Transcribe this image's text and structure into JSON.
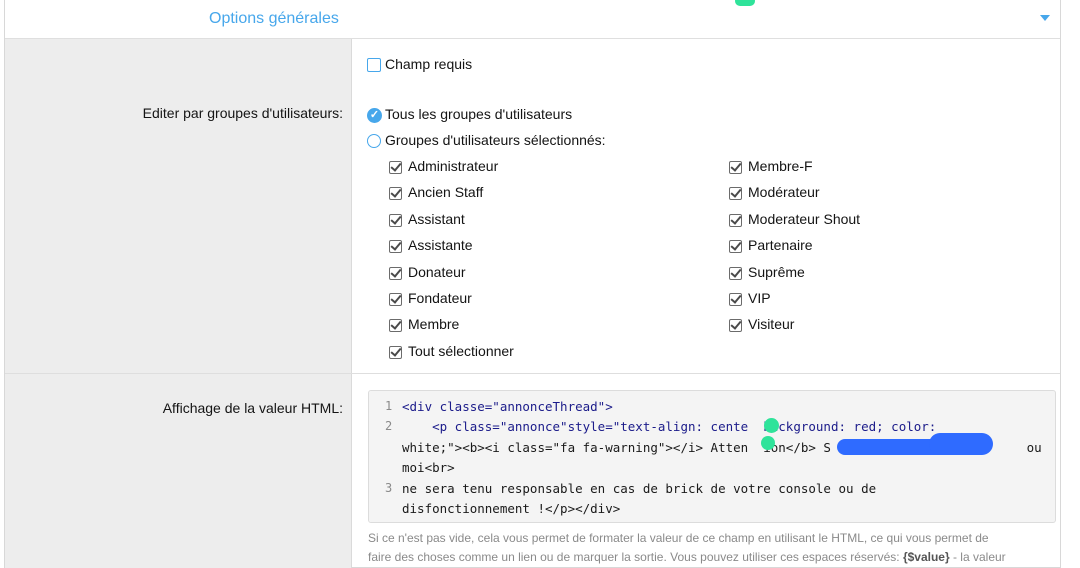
{
  "header": {
    "title": "Options générales"
  },
  "labels": {
    "edit_groups": "Editer par groupes d'utilisateurs:",
    "html_display": "Affichage de la valeur HTML:"
  },
  "options": {
    "required_field": "Champ requis",
    "all_groups": "Tous les groupes d'utilisateurs",
    "selected_groups": "Groupes d'utilisateurs sélectionnés:"
  },
  "groups_left": [
    "Administrateur",
    "Ancien Staff",
    "Assistant",
    "Assistante",
    "Donateur",
    "Fondateur",
    "Membre",
    "Tout sélectionner"
  ],
  "groups_right": [
    "Membre-F",
    "Modérateur",
    "Moderateur Shout",
    "Partenaire",
    "Suprême",
    "VIP",
    "Visiteur"
  ],
  "code": {
    "line_numbers": [
      "1",
      "2",
      "3"
    ],
    "l1": "<div classe=\"annonceThread\">",
    "l2a": "    <p class=\"annonce\"style=\"text-align: cente  background: red; color:",
    "l2b": "white;\"><b><i class=\"fa fa-warning\"></i> Atten  ion</b> S                          ou",
    "l2c": "moi<br>",
    "l3a": "ne sera tenu responsable en cas de brick de votre console ou de",
    "l3b": "disfonctionnement !</p></div>"
  },
  "help": {
    "line1": "Si ce n'est pas vide, cela vous permet de formater la valeur de ce champ en utilisant le HTML, ce qui vous permet de",
    "line2_pre": "faire des choses comme un lien ou de marquer la sortie. Vous pouvez utiliser ces espaces réservés: ",
    "placeholder": "{$value}",
    "line2_post": " - la valeur"
  },
  "colors": {
    "accent": "#47a7eb",
    "green_mark": "#2fe39a",
    "blue_redaction": "#2f6bff"
  }
}
